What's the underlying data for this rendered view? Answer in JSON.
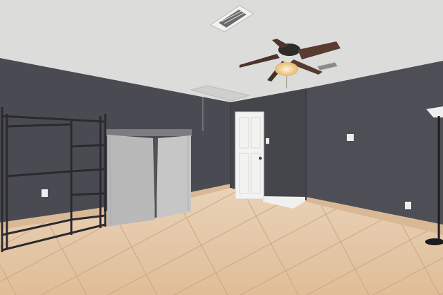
{
  "photo": {
    "subject": "empty-room-interior",
    "colors": {
      "ceiling": "#dcdcda",
      "wall_left": "#4a4b52",
      "wall_back": "#48494f",
      "wall_right": "#4e4f56",
      "floor": "#e7c7a6",
      "baseboard": "#d9b995",
      "door": "#f2f2f0",
      "wardrobe_cover": "#bdbdbd",
      "metal_rack": "#2c2c30",
      "fan_blade": "#5a3b30",
      "fan_light": "#f3d9a4"
    },
    "icons": [
      "ceiling-fan",
      "air-vent",
      "wardrobe",
      "metal-shelf-rack",
      "floor-lamp",
      "wall-outlet",
      "light-switch"
    ]
  }
}
